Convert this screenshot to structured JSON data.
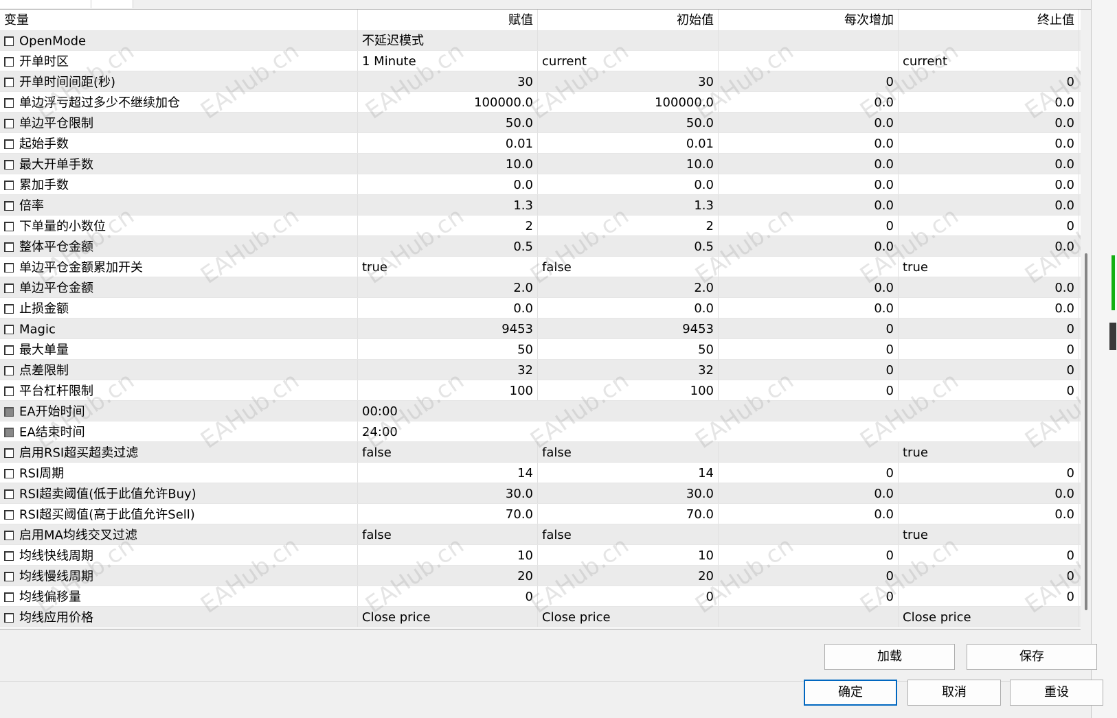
{
  "header": {
    "col_name": "变量",
    "col_value": "赋值",
    "col_start": "初始值",
    "col_step": "每次增加",
    "col_stop": "终止值"
  },
  "rows": [
    {
      "name": "OpenMode",
      "value": "不延迟模式",
      "start": "",
      "step": "",
      "stop": "",
      "align": "left",
      "check": "empty"
    },
    {
      "name": "开单时区",
      "value": "1 Minute",
      "start": "current",
      "step": "",
      "stop": "current",
      "align": "left",
      "check": "empty"
    },
    {
      "name": "开单时间间距(秒)",
      "value": "30",
      "start": "30",
      "step": "0",
      "stop": "0",
      "align": "right",
      "check": "empty"
    },
    {
      "name": "单边浮亏超过多少不继续加仓",
      "value": "100000.0",
      "start": "100000.0",
      "step": "0.0",
      "stop": "0.0",
      "align": "right",
      "check": "empty"
    },
    {
      "name": "单边平仓限制",
      "value": "50.0",
      "start": "50.0",
      "step": "0.0",
      "stop": "0.0",
      "align": "right",
      "check": "empty"
    },
    {
      "name": "起始手数",
      "value": "0.01",
      "start": "0.01",
      "step": "0.0",
      "stop": "0.0",
      "align": "right",
      "check": "empty"
    },
    {
      "name": "最大开单手数",
      "value": "10.0",
      "start": "10.0",
      "step": "0.0",
      "stop": "0.0",
      "align": "right",
      "check": "empty"
    },
    {
      "name": "累加手数",
      "value": "0.0",
      "start": "0.0",
      "step": "0.0",
      "stop": "0.0",
      "align": "right",
      "check": "empty"
    },
    {
      "name": "倍率",
      "value": "1.3",
      "start": "1.3",
      "step": "0.0",
      "stop": "0.0",
      "align": "right",
      "check": "empty"
    },
    {
      "name": "下单量的小数位",
      "value": "2",
      "start": "2",
      "step": "0",
      "stop": "0",
      "align": "right",
      "check": "empty"
    },
    {
      "name": "整体平仓金额",
      "value": "0.5",
      "start": "0.5",
      "step": "0.0",
      "stop": "0.0",
      "align": "right",
      "check": "empty"
    },
    {
      "name": "单边平仓金额累加开关",
      "value": "true",
      "start": "false",
      "step": "",
      "stop": "true",
      "align": "left",
      "check": "empty"
    },
    {
      "name": "单边平仓金额",
      "value": "2.0",
      "start": "2.0",
      "step": "0.0",
      "stop": "0.0",
      "align": "right",
      "check": "empty"
    },
    {
      "name": "止损金额",
      "value": "0.0",
      "start": "0.0",
      "step": "0.0",
      "stop": "0.0",
      "align": "right",
      "check": "empty"
    },
    {
      "name": "Magic",
      "value": "9453",
      "start": "9453",
      "step": "0",
      "stop": "0",
      "align": "right",
      "check": "empty"
    },
    {
      "name": "最大单量",
      "value": "50",
      "start": "50",
      "step": "0",
      "stop": "0",
      "align": "right",
      "check": "empty"
    },
    {
      "name": "点差限制",
      "value": "32",
      "start": "32",
      "step": "0",
      "stop": "0",
      "align": "right",
      "check": "empty"
    },
    {
      "name": "平台杠杆限制",
      "value": "100",
      "start": "100",
      "step": "0",
      "stop": "0",
      "align": "right",
      "check": "empty"
    },
    {
      "name": "EA开始时间",
      "value": "00:00",
      "start": "",
      "step": "",
      "stop": "",
      "align": "wide",
      "check": "grey"
    },
    {
      "name": "EA结束时间",
      "value": "24:00",
      "start": "",
      "step": "",
      "stop": "",
      "align": "wide",
      "check": "grey"
    },
    {
      "name": "启用RSI超买超卖过滤",
      "value": "false",
      "start": "false",
      "step": "",
      "stop": "true",
      "align": "left",
      "check": "empty"
    },
    {
      "name": "RSI周期",
      "value": "14",
      "start": "14",
      "step": "0",
      "stop": "0",
      "align": "right",
      "check": "empty"
    },
    {
      "name": "RSI超卖阈值(低于此值允许Buy)",
      "value": "30.0",
      "start": "30.0",
      "step": "0.0",
      "stop": "0.0",
      "align": "right",
      "check": "empty"
    },
    {
      "name": "RSI超买阈值(高于此值允许Sell)",
      "value": "70.0",
      "start": "70.0",
      "step": "0.0",
      "stop": "0.0",
      "align": "right",
      "check": "empty"
    },
    {
      "name": "启用MA均线交叉过滤",
      "value": "false",
      "start": "false",
      "step": "",
      "stop": "true",
      "align": "left",
      "check": "empty"
    },
    {
      "name": "均线快线周期",
      "value": "10",
      "start": "10",
      "step": "0",
      "stop": "0",
      "align": "right",
      "check": "empty"
    },
    {
      "name": "均线慢线周期",
      "value": "20",
      "start": "20",
      "step": "0",
      "stop": "0",
      "align": "right",
      "check": "empty"
    },
    {
      "name": "均线偏移量",
      "value": "0",
      "start": "0",
      "step": "0",
      "stop": "0",
      "align": "right",
      "check": "empty"
    },
    {
      "name": "均线应用价格",
      "value": "Close price",
      "start": "Close price",
      "step": "",
      "stop": "Close price",
      "align": "left",
      "check": "empty"
    }
  ],
  "buttons": {
    "load": "加载",
    "save": "保存",
    "ok": "确定",
    "cancel": "取消",
    "reset": "重设"
  },
  "watermark": "EAHub.cn",
  "colors": {
    "row_alt": "#ebebeb",
    "row_plain": "#ffffff",
    "primary_border": "#0067c0",
    "edge_green": "#12b012"
  }
}
